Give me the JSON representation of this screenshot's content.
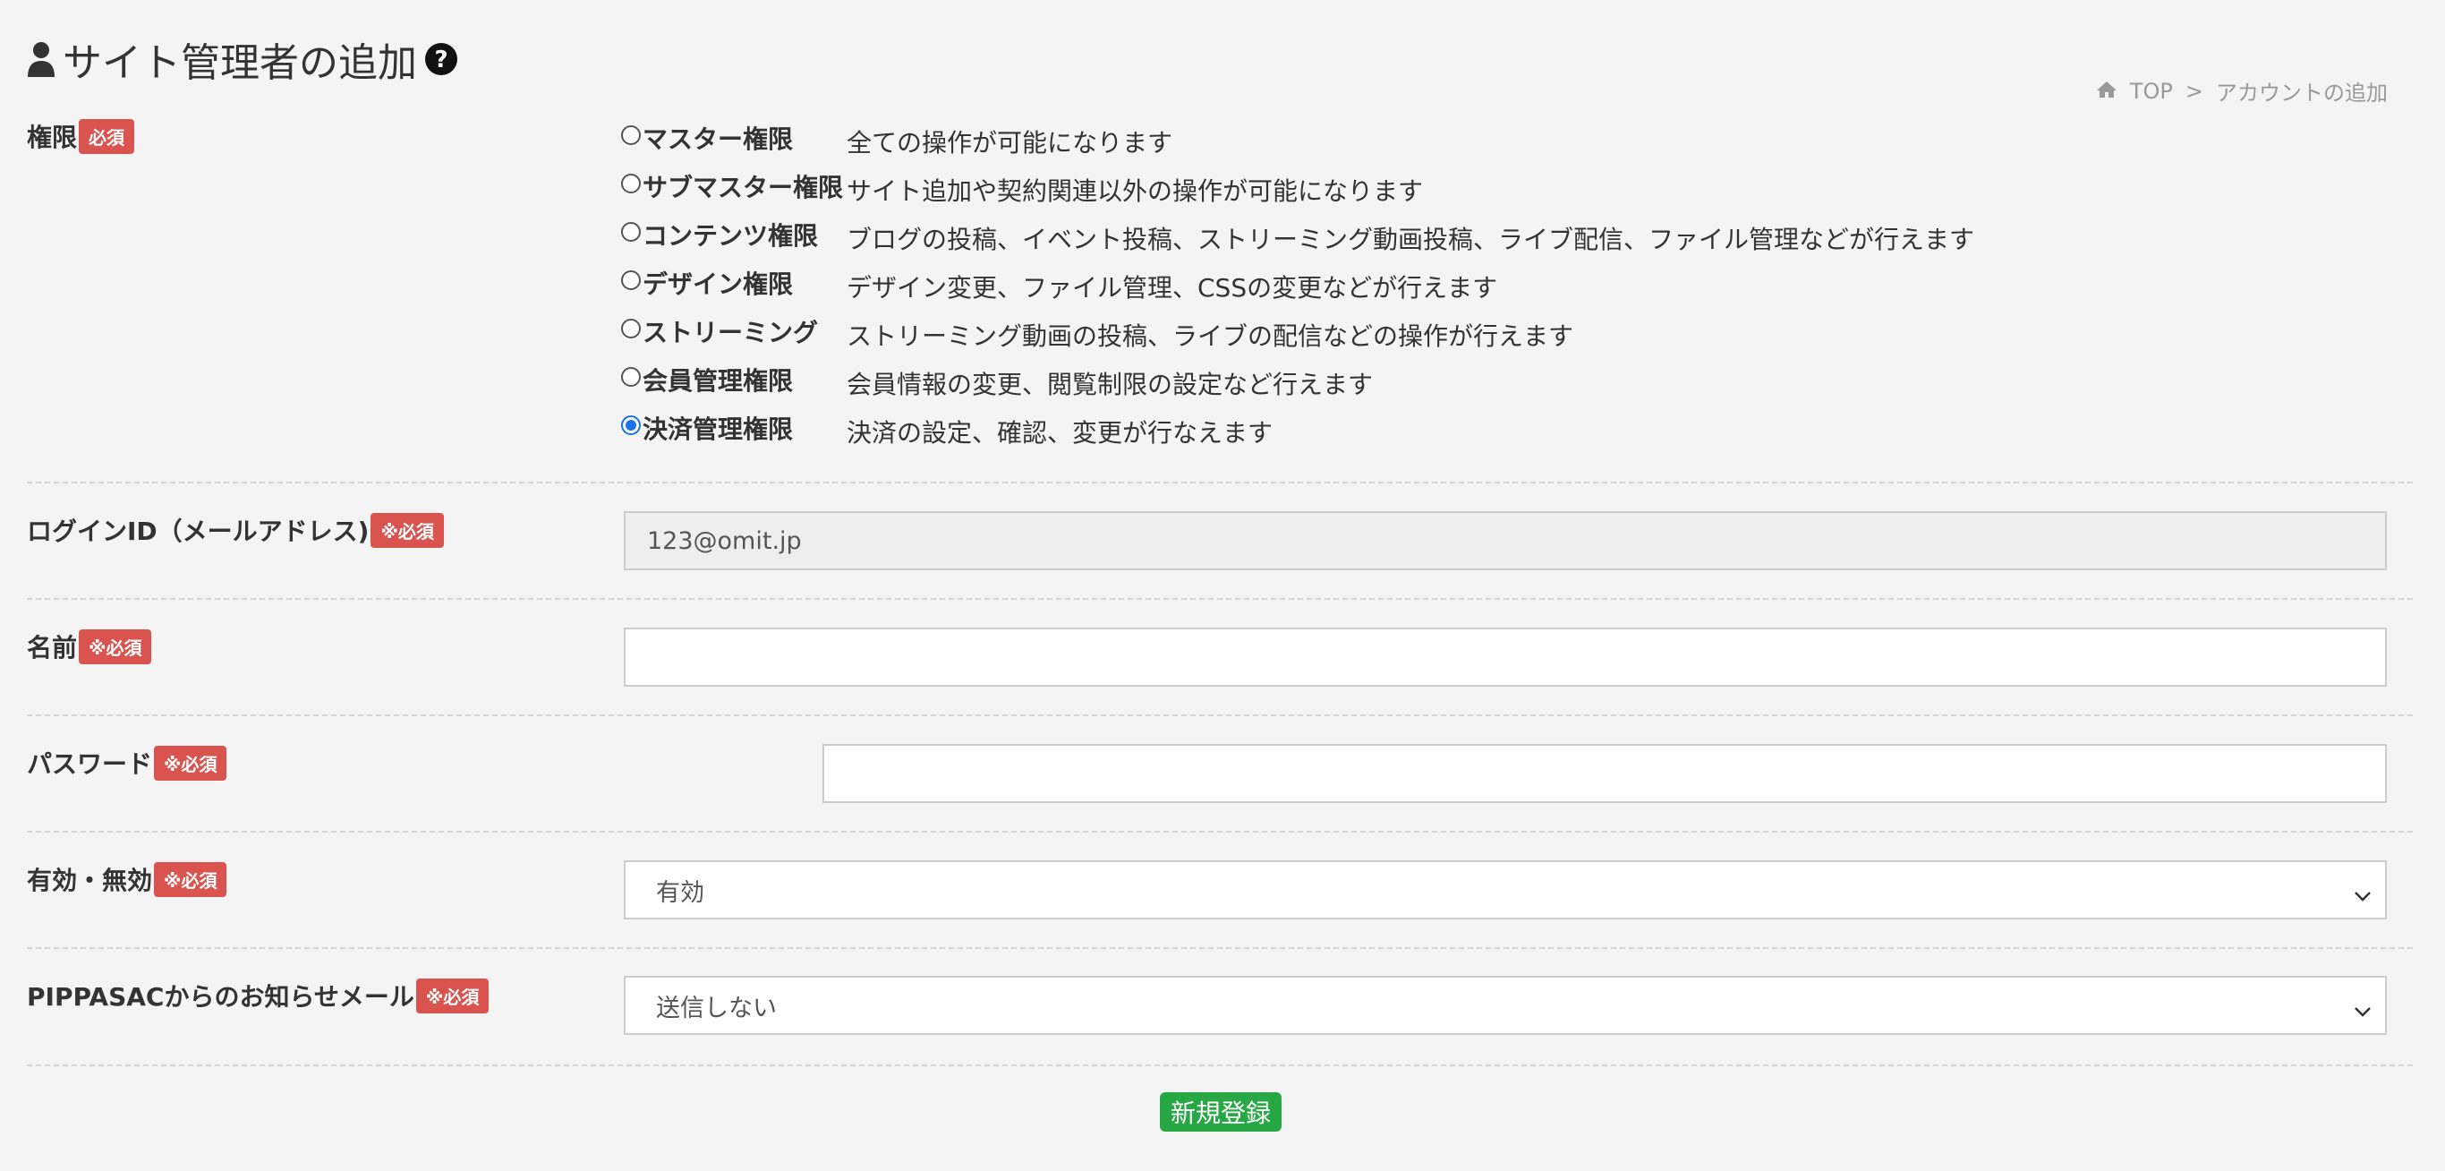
{
  "header": {
    "title": "サイト管理者の追加",
    "title_icon": "user-icon",
    "help_icon": "question-circle-icon"
  },
  "breadcrumb": {
    "home_icon": "home-icon",
    "top": "TOP",
    "separator": ">",
    "current": "アカウントの追加"
  },
  "form": {
    "role": {
      "label": "権限",
      "required": "必須",
      "options": [
        {
          "name": "マスター権限",
          "desc": "全ての操作が可能になります",
          "checked": false
        },
        {
          "name": "サブマスター権限",
          "desc": "サイト追加や契約関連以外の操作が可能になります",
          "checked": false
        },
        {
          "name": "コンテンツ権限",
          "desc": "ブログの投稿、イベント投稿、ストリーミング動画投稿、ライブ配信、ファイル管理などが行えます",
          "checked": false
        },
        {
          "name": "デザイン権限",
          "desc": "デザイン変更、ファイル管理、CSSの変更などが行えます",
          "checked": false
        },
        {
          "name": "ストリーミング",
          "desc": "ストリーミング動画の投稿、ライブの配信などの操作が行えます",
          "checked": false
        },
        {
          "name": "会員管理権限",
          "desc": "会員情報の変更、閲覧制限の設定など行えます",
          "checked": false
        },
        {
          "name": "決済管理権限",
          "desc": "決済の設定、確認、変更が行なえます",
          "checked": true
        }
      ]
    },
    "login_id": {
      "label": "ログインID（メールアドレス)",
      "required": "※必須",
      "value": "123@omit.jp"
    },
    "name": {
      "label": "名前",
      "required": "※必須",
      "value": ""
    },
    "password": {
      "label": "パスワード",
      "required": "※必須",
      "value": ""
    },
    "status": {
      "label": "有効・無効",
      "required": "※必須",
      "value": "有効"
    },
    "notify": {
      "label": "PIPPASACからのお知らせメール",
      "required": "※必須",
      "value": "送信しない"
    },
    "submit_label": "新規登録"
  },
  "colors": {
    "required_badge": "#d9534f",
    "submit": "#28a745",
    "radio_checked": "#1a73e8"
  }
}
